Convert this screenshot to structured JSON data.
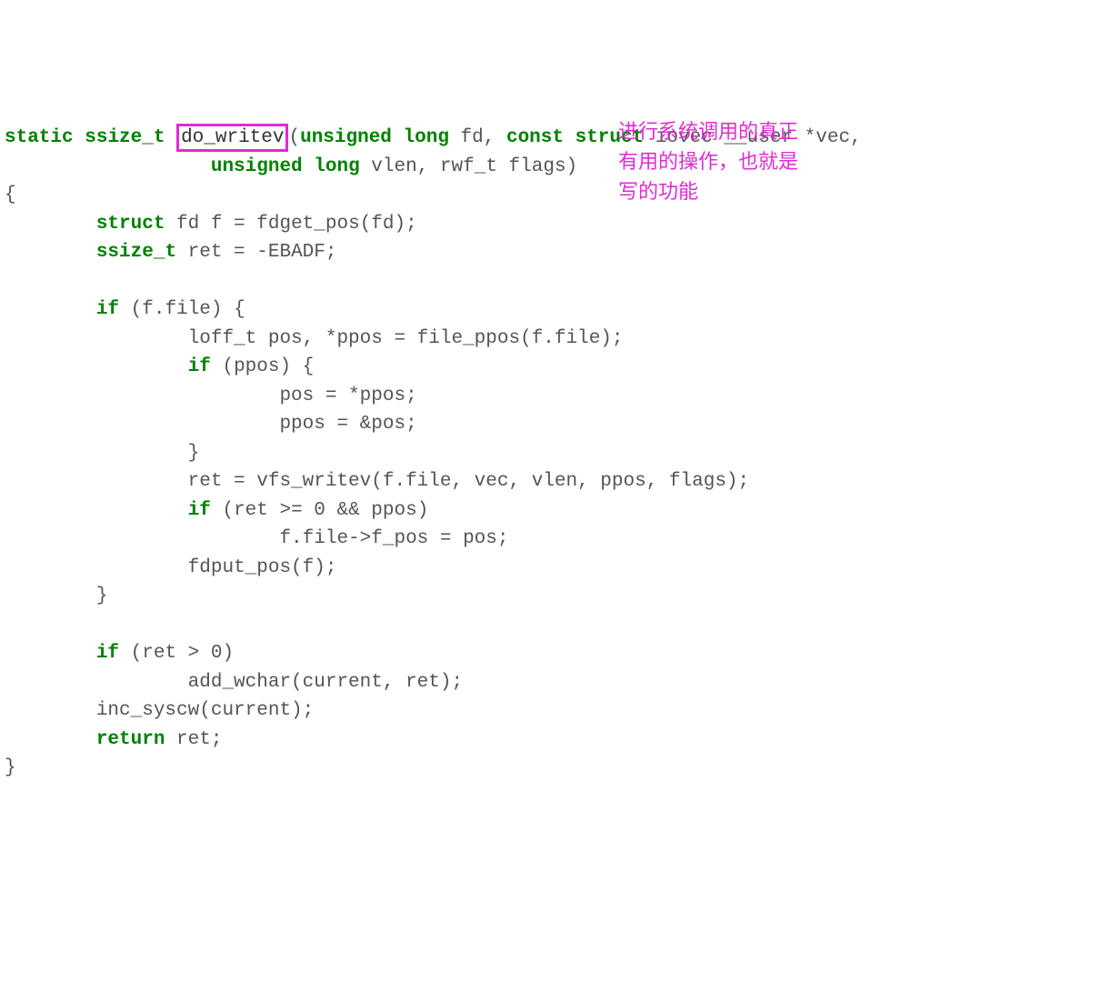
{
  "code": {
    "l1": {
      "kw_static": "static",
      "typ_ssize": "ssize_t",
      "fn_name": "do_writev",
      "open_paren": "(",
      "kw_unsigned1": "unsigned",
      "kw_long1": "long",
      "p_fd": " fd, ",
      "kw_const": "const",
      "kw_struct": "struct",
      "rest1": " iovec __user *vec,"
    },
    "l2": {
      "indent": "                  ",
      "kw_unsigned2": "unsigned",
      "kw_long2": "long",
      "rest2": " vlen, rwf_t flags)"
    },
    "l3": "{",
    "l4": {
      "indent": "        ",
      "kw_struct2": "struct",
      "rest": " fd f = fdget_pos(fd);"
    },
    "l5": {
      "indent": "        ",
      "typ2": "ssize_t",
      "rest": " ret = -EBADF;"
    },
    "l6": "",
    "l7": {
      "indent": "        ",
      "kw_if": "if",
      "rest": " (f.file) {"
    },
    "l8": "                loff_t pos, *ppos = file_ppos(f.file);",
    "l9": {
      "indent": "                ",
      "kw_if": "if",
      "rest": " (ppos) {"
    },
    "l10": "                        pos = *ppos;",
    "l11": "                        ppos = &pos;",
    "l12": "                }",
    "l13": "                ret = vfs_writev(f.file, vec, vlen, ppos, flags);",
    "l14": {
      "indent": "                ",
      "kw_if": "if",
      "rest": " (ret >= 0 && ppos)"
    },
    "l15": "                        f.file->f_pos = pos;",
    "l16": "                fdput_pos(f);",
    "l17": "        }",
    "l18": "",
    "l19": {
      "indent": "        ",
      "kw_if": "if",
      "rest": " (ret > 0)"
    },
    "l20": "                add_wchar(current, ret);",
    "l21": "        inc_syscw(current);",
    "l22": {
      "indent": "        ",
      "kw_return": "return",
      "rest": " ret;"
    },
    "l23": "}"
  },
  "annotation": {
    "line1": "进行系统调用的真正",
    "line2": "有用的操作，也就是",
    "line3": "写的功能"
  }
}
